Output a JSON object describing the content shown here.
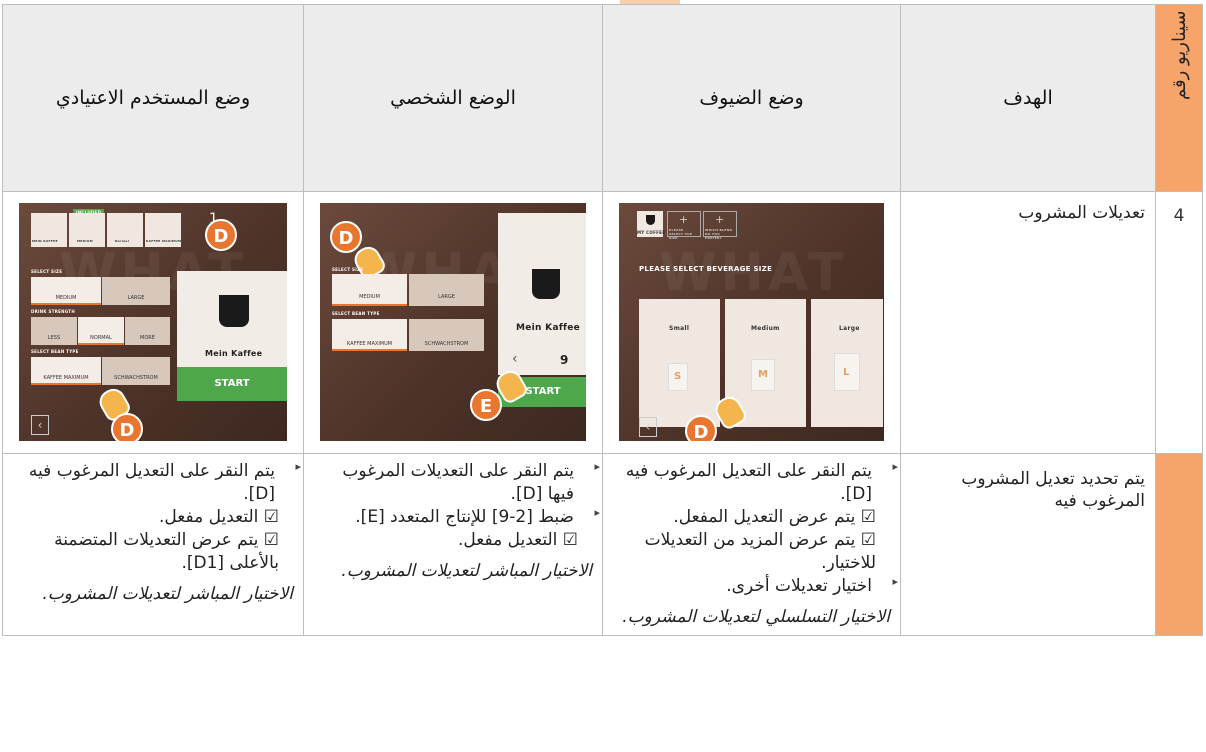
{
  "header": {
    "side_label": "سيناريو رقم",
    "col_goal": "الهدف",
    "col_guest": "وضع الضيوف",
    "col_personal": "الوضع الشخصي",
    "col_user": "وضع المستخدم الاعتيادي"
  },
  "row": {
    "number": "4",
    "goal_title": "تعديلات المشروب",
    "goal_result": "يتم تحديد تعديل المشروب المرغوب فيه"
  },
  "guest_screen": {
    "my_coffee": "MY COFFEE",
    "add1": "PLEASE SELECT CUP SIZE",
    "add2": "WHICH BLEND DO YOU PREFER?",
    "prompt": "PLEASE SELECT BEVERAGE SIZE",
    "sizes": [
      "Small",
      "Medium",
      "Large"
    ],
    "letters": [
      "S",
      "M",
      "L"
    ],
    "badge": "D"
  },
  "personal_screen": {
    "select_size": "SELECT SIZE",
    "medium": "MEDIUM",
    "large": "LARGE",
    "select_bean": "SELECT BEAN TYPE",
    "bean1": "KAFFEE MAXIMUM",
    "bean2": "SCHWACHSTROM",
    "product": "Mein Kaffee",
    "count": "9",
    "start": "START",
    "badge_d": "D",
    "badge_e": "E"
  },
  "user_screen": {
    "included": "INCLUDED",
    "top_items": [
      "MEIN KAFFEE",
      "MEDIUM",
      "Normal",
      "KAFFEE MAXIMUM"
    ],
    "select_size": "SELECT SIZE",
    "medium": "MEDIUM",
    "large": "LARGE",
    "drink_strength": "DRINK STRENGTH",
    "less": "LESS",
    "normal": "NORMAL",
    "more": "MORE",
    "select_bean": "SELECT BEAN TYPE",
    "bean1": "KAFFEE MAXIMUM",
    "bean2": "SCHWACHSTROM",
    "product": "Mein Kaffee",
    "start": "START",
    "badge_d1": "1",
    "badge_d": "D"
  },
  "guest_text": {
    "b1": "يتم النقر على التعديل المرغوب فيه [D].",
    "c1": "☑  يتم عرض التعديل المفعل.",
    "c2": "☑  يتم عرض المزيد من التعديلات للاختيار.",
    "b2": "اختيار تعديلات أخرى.",
    "note": "الاختيار التسلسلي لتعديلات المشروب."
  },
  "personal_text": {
    "b1": "يتم النقر على التعديلات المرغوب فيها [D].",
    "b2": "ضبط [2-9] للإنتاج المتعدد [E].",
    "c1": "☑  التعديل مفعل.",
    "note": "الاختيار المباشر لتعديلات المشروب."
  },
  "user_text": {
    "b1": "يتم النقر على التعديل المرغوب فيه [D].",
    "c1": "☑  التعديل مفعل.",
    "c2": "☑  يتم عرض التعديلات المتضمنة بالأعلى [D1].",
    "note": "الاختيار المباشر لتعديلات المشروب."
  }
}
